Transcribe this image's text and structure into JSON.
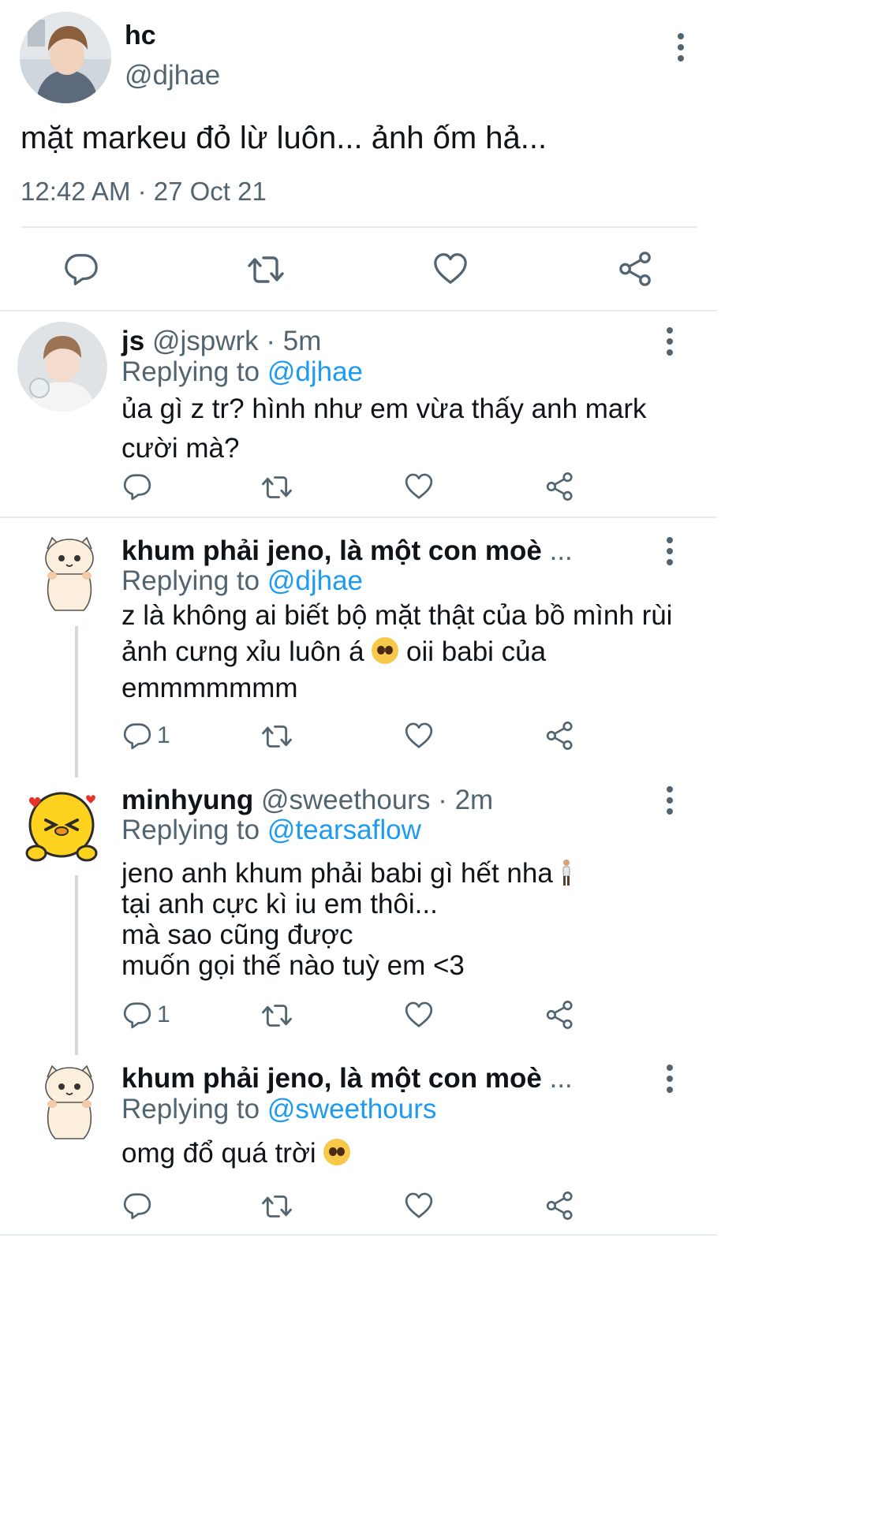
{
  "main_tweet": {
    "display_name": "hc",
    "handle": "@djhae",
    "text": "mặt markeu đỏ lừ luôn... ảnh ốm hả...",
    "timestamp": "12:42 AM · 27 Oct 21"
  },
  "replies": [
    {
      "display_name": "js",
      "handle": "@jspwrk",
      "time": "· 5m",
      "replying_label": "Replying to",
      "replying_handle": "@djhae",
      "text": "ủa gì z tr? hình như em vừa thấy anh mark cười mà?",
      "reply_count": ""
    },
    {
      "display_name": "khum phải jeno, là một con moè",
      "ellipsis": "...",
      "replying_label": "Replying to",
      "replying_handle": "@djhae",
      "text_line1": "z là không ai biết bộ mặt thật của bồ mình rùi",
      "text_line2a": "ảnh cưng xỉu luôn á",
      "text_line2b": "oii babi của",
      "text_line3": "emmmmmmm",
      "reply_count": "1"
    },
    {
      "display_name": "minhyung",
      "handle": "@sweethours",
      "time": "· 2m",
      "replying_label": "Replying to",
      "replying_handle": "@tearsaflow",
      "text_line1": "jeno anh khum phải babi gì hết nha",
      "text_line2": "tại anh cực kì iu em thôi...",
      "text_line3": "mà sao cũng được",
      "text_line4": "muốn gọi thế nào tuỳ em <3",
      "reply_count": "1"
    },
    {
      "display_name": "khum phải jeno, là một con moè",
      "ellipsis": "...",
      "replying_label": "Replying to",
      "replying_handle": "@sweethours",
      "text": "omg đổ quá trời",
      "reply_count": ""
    }
  ],
  "icons": {
    "reply": "reply-icon",
    "retweet": "retweet-icon",
    "like": "heart-icon",
    "share": "share-icon",
    "more": "more-vertical-icon"
  },
  "colors": {
    "link": "#1d9bf0",
    "secondary_text": "#536471",
    "divider": "#e6ecf0"
  }
}
